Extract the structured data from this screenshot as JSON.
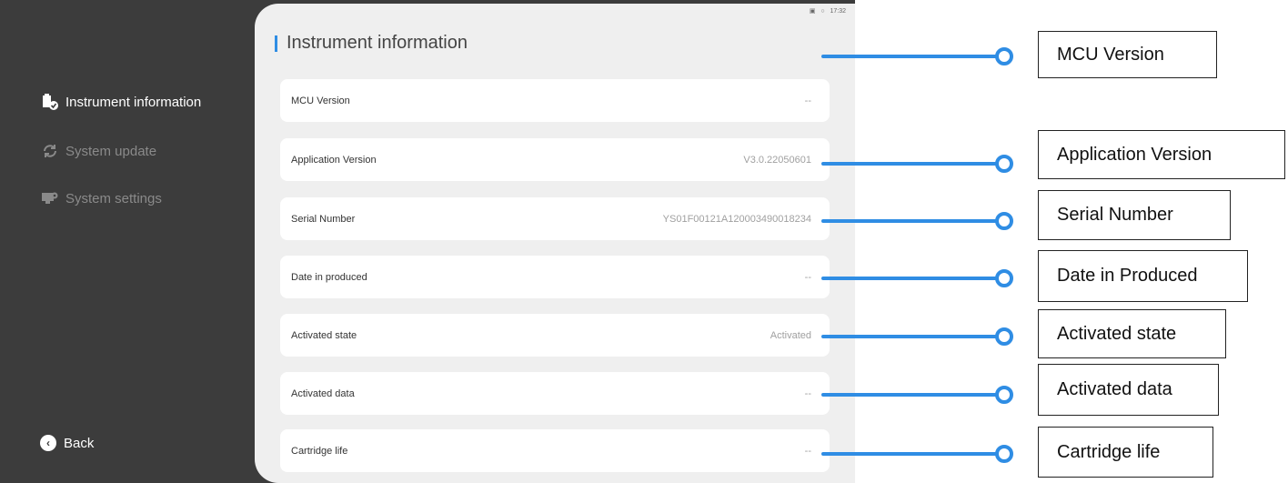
{
  "sidebar": {
    "items": [
      {
        "label": "Instrument information",
        "icon": "instrument-icon",
        "active": true
      },
      {
        "label": "System update",
        "icon": "refresh-icon",
        "active": false
      },
      {
        "label": "System settings",
        "icon": "settings-monitor-icon",
        "active": false
      }
    ],
    "back_label": "Back"
  },
  "statusbar": {
    "time": "17:32"
  },
  "main": {
    "title": "Instrument information",
    "rows": [
      {
        "label": "MCU Version",
        "value": "--"
      },
      {
        "label": "Application Version",
        "value": "V3.0.22050601"
      },
      {
        "label": "Serial Number",
        "value": "YS01F00121A120003490018234"
      },
      {
        "label": "Date in produced",
        "value": "--"
      },
      {
        "label": "Activated state",
        "value": "Activated"
      },
      {
        "label": "Activated data",
        "value": "--"
      },
      {
        "label": "Cartridge life",
        "value": "--"
      }
    ]
  },
  "annotations": [
    "MCU Version",
    "Application Version",
    "Serial Number",
    "Date in Produced",
    "Activated state",
    "Activated data",
    "Cartridge life"
  ],
  "colors": {
    "accent": "#2f8de4",
    "sidebar_bg": "#3c3c3c",
    "panel_bg": "#efefef"
  }
}
